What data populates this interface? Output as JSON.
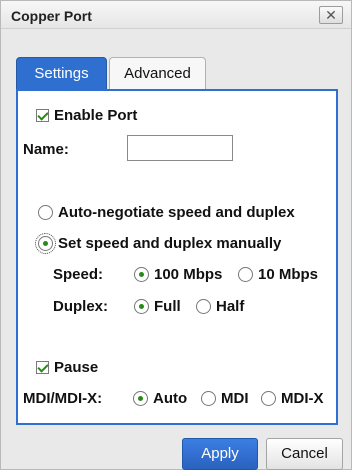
{
  "dialog": {
    "title": "Copper Port",
    "close_glyph": "✕"
  },
  "tabs": [
    {
      "label": "Settings",
      "active": true
    },
    {
      "label": "Advanced",
      "active": false
    }
  ],
  "settings": {
    "enable_port": {
      "label": "Enable Port",
      "checked": true
    },
    "name": {
      "label": "Name:",
      "value": ""
    },
    "auto_negotiate": {
      "label": "Auto-negotiate speed and duplex",
      "selected": false
    },
    "manual": {
      "label": "Set speed and duplex manually",
      "selected": true
    },
    "speed": {
      "label": "Speed:",
      "options": [
        {
          "label": "100 Mbps",
          "selected": true
        },
        {
          "label": "10 Mbps",
          "selected": false
        }
      ]
    },
    "duplex": {
      "label": "Duplex:",
      "options": [
        {
          "label": "Full",
          "selected": true
        },
        {
          "label": "Half",
          "selected": false
        }
      ]
    },
    "pause": {
      "label": "Pause",
      "checked": true
    },
    "mdi": {
      "label": "MDI/MDI-X:",
      "options": [
        {
          "label": "Auto",
          "selected": true
        },
        {
          "label": "MDI",
          "selected": false
        },
        {
          "label": "MDI-X",
          "selected": false
        }
      ]
    }
  },
  "buttons": {
    "apply": "Apply",
    "cancel": "Cancel"
  }
}
